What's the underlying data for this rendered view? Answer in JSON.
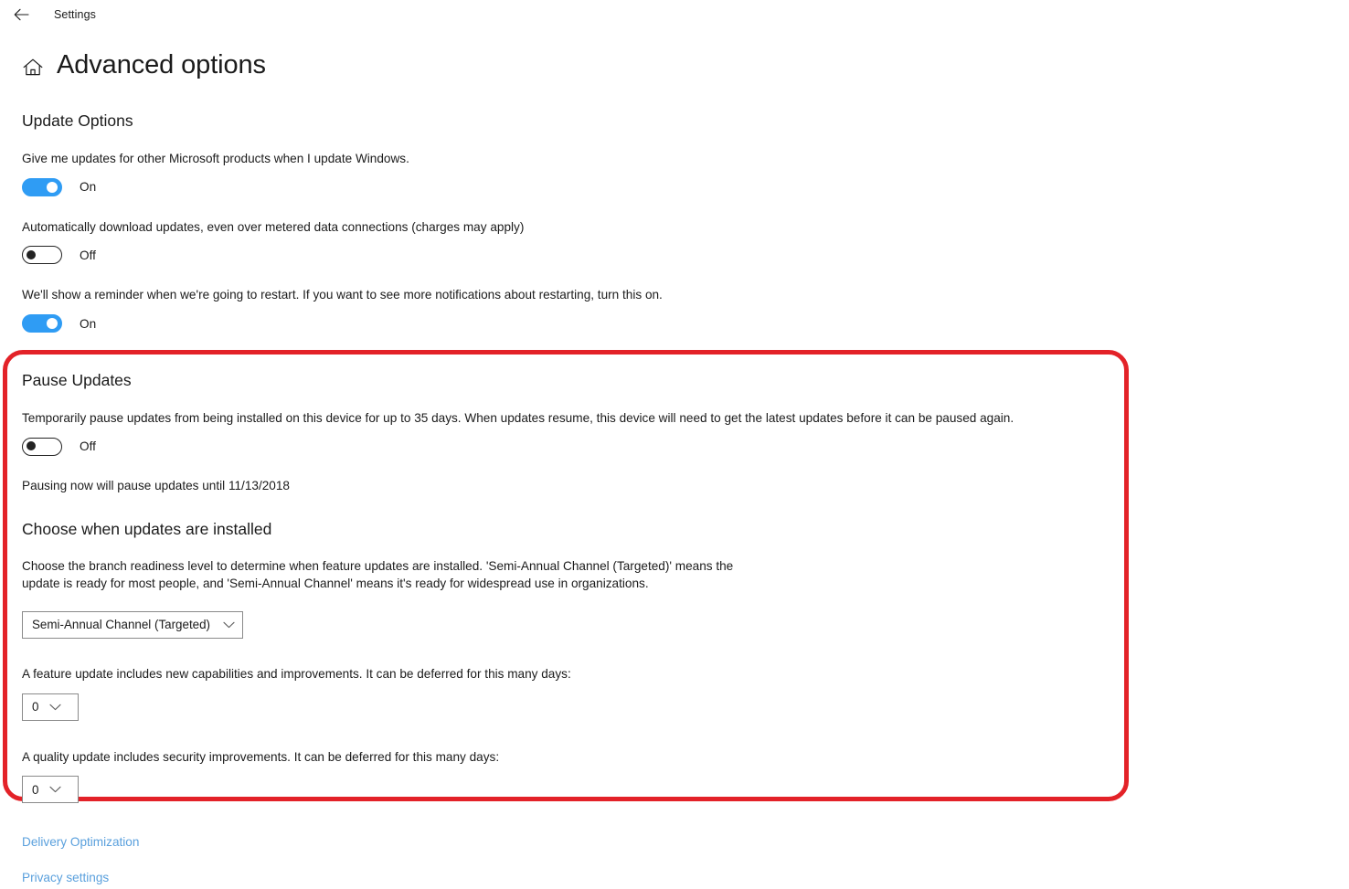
{
  "titlebar": {
    "back_icon": "back-arrow-icon",
    "app_title": "Settings"
  },
  "header": {
    "home_icon": "home-icon",
    "title": "Advanced options"
  },
  "update_options": {
    "heading": "Update Options",
    "items": [
      {
        "description": "Give me updates for other Microsoft products when I update Windows.",
        "toggle_state": "on",
        "toggle_label": "On"
      },
      {
        "description": "Automatically download updates, even over metered data connections (charges may apply)",
        "toggle_state": "off",
        "toggle_label": "Off"
      },
      {
        "description": "We'll show a reminder when we're going to restart. If you want to see more notifications about restarting, turn this on.",
        "toggle_state": "on",
        "toggle_label": "On"
      }
    ]
  },
  "pause_updates": {
    "heading": "Pause Updates",
    "description": "Temporarily pause updates from being installed on this device for up to 35 days. When updates resume, this device will need to get the latest updates before it can be paused again.",
    "toggle_state": "off",
    "toggle_label": "Off",
    "note": "Pausing now will pause updates until 11/13/2018"
  },
  "choose_when": {
    "heading": "Choose when updates are installed",
    "description": "Choose the branch readiness level to determine when feature updates are installed. 'Semi-Annual Channel (Targeted)' means the update is ready for most people, and 'Semi-Annual Channel' means it's ready for widespread use in organizations.",
    "branch_dropdown": {
      "value": "Semi-Annual Channel (Targeted)",
      "options": [
        "Semi-Annual Channel (Targeted)",
        "Semi-Annual Channel"
      ]
    },
    "feature_update": {
      "description": "A feature update includes new capabilities and improvements. It can be deferred for this many days:",
      "value": "0"
    },
    "quality_update": {
      "description": "A quality update includes security improvements. It can be deferred for this many days:",
      "value": "0"
    }
  },
  "links": [
    {
      "label": "Delivery Optimization"
    },
    {
      "label": "Privacy settings"
    }
  ],
  "annotation": {
    "shape": "rounded-rectangle",
    "color": "#e32228",
    "stroke_width_px": 5
  },
  "colors": {
    "toggle_on": "#2f9cf4",
    "toggle_off_border": "#232323",
    "link": "#5aa0dd",
    "annotation_red": "#e32228",
    "text": "#1b1b1b",
    "dropdown_border": "#8a8a8a"
  }
}
